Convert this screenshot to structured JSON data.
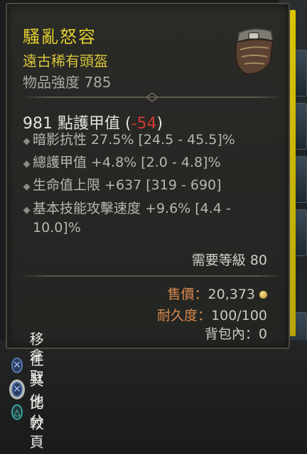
{
  "item": {
    "name": "騷亂怒容",
    "type": "遠古稀有頭盔",
    "power": "物品強度 785",
    "armor_value": "981 點護甲值",
    "armor_open": "(",
    "armor_delta": "-54",
    "armor_close": ")",
    "icon": "helmet-mask-icon"
  },
  "affixes": [
    {
      "text": "暗影抗性 27.5% [24.5 - 45.5]%"
    },
    {
      "text": "總護甲值 +4.8% [2.0 - 4.8]%"
    },
    {
      "text": "生命值上限 +637 [319 - 690]"
    },
    {
      "text": "基本技能攻擊速度 +9.6% [4.4 -",
      "text2": "10.0]%"
    }
  ],
  "requirement": "需要等級 80",
  "stats": {
    "sell_label": "售價：",
    "sell_value": "20,373",
    "durability_label": "耐久度：",
    "durability_value": "100/100",
    "backpack_label": "背包內：",
    "backpack_value": "0"
  },
  "actions": [
    {
      "label": "拿取",
      "button": "cross-button-icon"
    },
    {
      "label": "移往其他分頁",
      "button": "cross-button-icon"
    },
    {
      "label": "比較",
      "button": "triangle-button-icon"
    }
  ],
  "colors": {
    "title": "#e3cf2d",
    "negative": "#d23a32",
    "label_orange": "#d98a4d"
  }
}
